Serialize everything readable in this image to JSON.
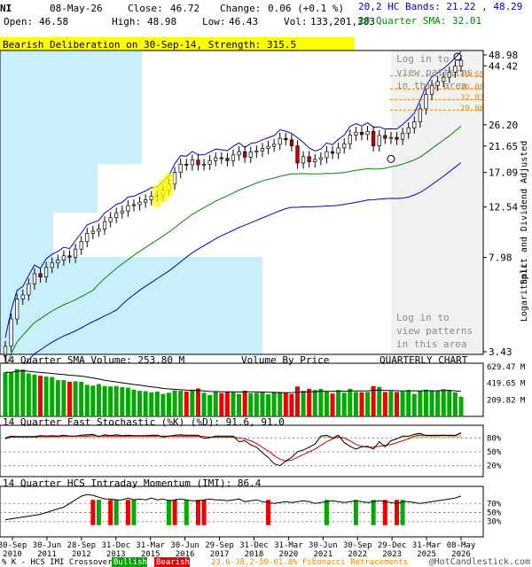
{
  "header": {
    "symbol": "NI",
    "date": "08-May-26",
    "close_label": "Close:",
    "close": "46.72",
    "change_label": "Change:",
    "change": "0.06 (+0.1 %)",
    "open_label": "Open:",
    "open": "46.58",
    "high_label": "High:",
    "high": "48.98",
    "low_label": "Low:",
    "low": "46.43",
    "vol_label": "Vol:",
    "vol": "133,201,383",
    "hc_bands": "20,2 HC Bands: 21.22 , 48.29",
    "sma_label": "20 Quarter SMA: 32.01"
  },
  "banner": "Bearish Deliberation on 30-Sep-14, Strength: 315.5",
  "login_text": [
    "Log in to",
    "view patterns",
    "in this area"
  ],
  "right_axis_label": "Split and Dividend Adjusted",
  "log_label": "Logarithmic",
  "fib_labels": [
    "40.55",
    "36.08",
    "32.83",
    "29.88"
  ],
  "colors": {
    "bullish": "#00aa00",
    "bearish": "#ee0000",
    "sma": "#008800",
    "band": "#0000cc",
    "vbp": "#c8f0fa",
    "fib": "#ee8800",
    "volume_sma": "#000000",
    "stoch_k": "#000000",
    "stoch_d": "#cc0000"
  },
  "chart_data": {
    "type": "candlestick",
    "y_ticks": [
      48.98,
      44.42,
      26.2,
      21.65,
      17.09,
      12.54,
      7.98,
      3.43
    ],
    "x_ticks": [
      "30-Sep\n2010",
      "30-Jun\n2011",
      "28-Sep\n2012",
      "31-Dec\n2013",
      "31-Mar\n2015",
      "30-Jun\n2016",
      "29-Sep\n2017",
      "31-Dec\n2018",
      "31-Mar\n2020",
      "30-Jun\n2021",
      "30-Sep\n2022",
      "29-Dec\n2023",
      "31-Mar\n2025",
      "08-May\n2026"
    ],
    "price_close": [
      3.6,
      4.6,
      5.5,
      5.7,
      6.3,
      6.9,
      6.7,
      7.3,
      7.6,
      7.8,
      8.1,
      8.0,
      8.6,
      9.2,
      9.9,
      10.1,
      10.3,
      11.0,
      11.4,
      11.9,
      12.1,
      12.7,
      12.8,
      13.1,
      13.4,
      13.8,
      13.9,
      14.6,
      15.4,
      17.1,
      18.4,
      18.3,
      19.1,
      18.3,
      18.4,
      19.0,
      19.5,
      19.4,
      19.0,
      20.0,
      20.6,
      19.6,
      20.5,
      20.7,
      21.2,
      21.6,
      22.0,
      23.2,
      22.9,
      21.7,
      18.6,
      19.7,
      18.8,
      19.2,
      19.5,
      20.6,
      20.3,
      21.3,
      22.1,
      23.9,
      24.5,
      24.0,
      24.7,
      21.7,
      23.8,
      23.2,
      23.4,
      23.0,
      24.3,
      25.5,
      26.9,
      30.2,
      34.4,
      37.3,
      38.6,
      40.1,
      42.0,
      44.3,
      46.7
    ],
    "volume": [
      560,
      560,
      600,
      595,
      545,
      530,
      515,
      505,
      500,
      460,
      460,
      440,
      445,
      440,
      400,
      390,
      410,
      385,
      380,
      385,
      370,
      365,
      340,
      325,
      320,
      305,
      315,
      285,
      300,
      330,
      325,
      315,
      340,
      355,
      300,
      270,
      320,
      295,
      310,
      305,
      285,
      325,
      295,
      300,
      310,
      280,
      310,
      310,
      300,
      285,
      380,
      325,
      350,
      335,
      350,
      320,
      290,
      335,
      300,
      350,
      310,
      305,
      310,
      385,
      375,
      310,
      320,
      310,
      315,
      335,
      285,
      325,
      340,
      330,
      320,
      345,
      330,
      305,
      250
    ],
    "stochastic": {
      "k": [
        80,
        84,
        83,
        83,
        83,
        83,
        85,
        84,
        85,
        84,
        86,
        84,
        84,
        86,
        87,
        88,
        83,
        87,
        85,
        87,
        85,
        86,
        85,
        85,
        85,
        86,
        86,
        82,
        84,
        86,
        87,
        86,
        86,
        86,
        79,
        81,
        84,
        84,
        84,
        84,
        72,
        74,
        65,
        60,
        48,
        38,
        24,
        20,
        30,
        38,
        50,
        54,
        60,
        67,
        84,
        86,
        80,
        86,
        70,
        62,
        56,
        61,
        62,
        56,
        72,
        61,
        74,
        78,
        84,
        84,
        88,
        90,
        85,
        85,
        85,
        86,
        85,
        85,
        91.6
      ],
      "d": [
        78,
        82,
        82,
        82,
        82,
        82,
        83,
        83,
        83,
        83,
        84,
        84,
        84,
        84,
        84,
        85,
        84,
        84,
        84,
        84,
        84,
        84,
        84,
        84,
        84,
        84,
        84,
        84,
        84,
        84,
        84,
        84,
        84,
        84,
        83,
        82,
        82,
        82,
        82,
        82,
        80,
        78,
        74,
        68,
        60,
        52,
        42,
        34,
        30,
        32,
        38,
        44,
        50,
        56,
        64,
        72,
        78,
        82,
        80,
        74,
        66,
        62,
        60,
        60,
        62,
        64,
        66,
        70,
        74,
        78,
        84,
        86,
        86,
        86,
        86,
        86,
        86,
        86,
        91.0
      ],
      "ticks": [
        "80%",
        "50%",
        "20%"
      ]
    },
    "imi": {
      "values": [
        34,
        36,
        38,
        40,
        42,
        44,
        46,
        50,
        54,
        58,
        62,
        70,
        78,
        86,
        90,
        88,
        84,
        80,
        80,
        78,
        78,
        82,
        78,
        80,
        78,
        82,
        78,
        80,
        76,
        78,
        80,
        78,
        76,
        76,
        78,
        80,
        78,
        78,
        76,
        78,
        80,
        74,
        76,
        78,
        74,
        72,
        70,
        72,
        74,
        72,
        74,
        76,
        74,
        70,
        72,
        74,
        76,
        74,
        72,
        74,
        76,
        74,
        72,
        74,
        76,
        74,
        72,
        70,
        74,
        74,
        72,
        70,
        72,
        74,
        76,
        78,
        80,
        82,
        86.4
      ],
      "ticks": [
        "70%",
        "50%",
        "30%"
      ]
    },
    "volume_ticks": [
      "629.47 M",
      "419.65 M",
      "209.82 M"
    ],
    "panel_labels": {
      "volume": "14 Quarter SMA Volume: 253.80 M",
      "vbp": "Volume By Price",
      "period": "QUARTERLY CHART",
      "stoch": "14 Quarter Fast Stochastic (%K) (%D): 91.6, 91.0",
      "imi": "14 Quarter HCS Intraday Momentum (IMI): 86.4"
    },
    "footer": {
      "left": "% K - HCS IMI Crossover:",
      "bullish": "Bullish",
      "bearish": "Bearish",
      "fib": "23.6-38.2-50-61.8% Fibonacci Retracements",
      "brand": "@HotCandlestick.com"
    }
  }
}
